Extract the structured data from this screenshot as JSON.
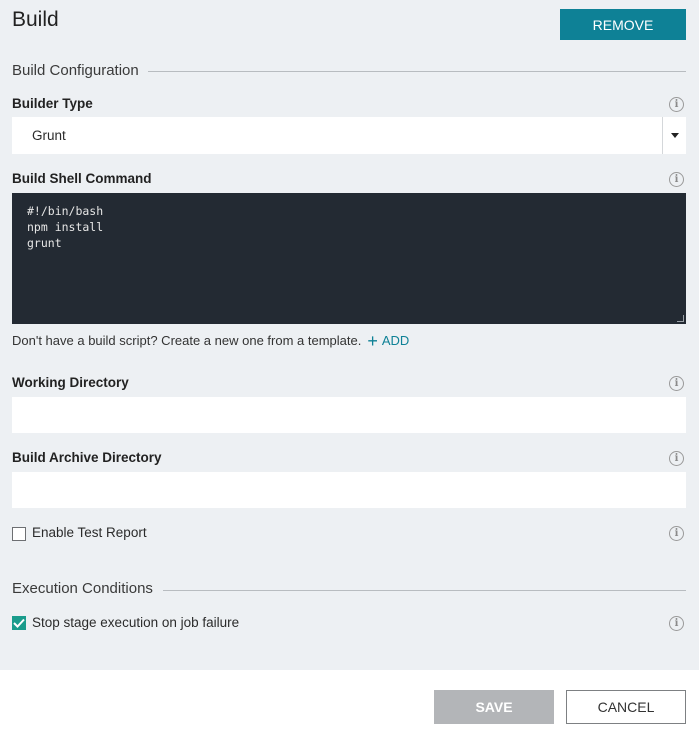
{
  "header": {
    "title": "Build",
    "remove_label": "REMOVE"
  },
  "build_config": {
    "section_title": "Build Configuration",
    "builder_type": {
      "label": "Builder Type",
      "value": "Grunt",
      "icon": "info-icon"
    },
    "shell_command": {
      "label": "Build Shell Command",
      "lines": [
        "#!/bin/bash",
        "npm install",
        "grunt"
      ]
    },
    "helper_text": "Don't have a build script? Create a new one from a template.",
    "add_label": "ADD",
    "working_dir": {
      "label": "Working Directory",
      "value": ""
    },
    "archive_dir": {
      "label": "Build Archive Directory",
      "value": ""
    },
    "test_report": {
      "label": "Enable Test Report",
      "checked": false
    }
  },
  "execution": {
    "section_title": "Execution Conditions",
    "stop_on_failure": {
      "label": "Stop stage execution on job failure",
      "checked": true
    }
  },
  "footer": {
    "save_label": "SAVE",
    "cancel_label": "CANCEL"
  },
  "colors": {
    "accent": "#0e8196",
    "check": "#1a9c8c",
    "panel_bg": "#edf0f3",
    "code_bg": "#232a33"
  }
}
